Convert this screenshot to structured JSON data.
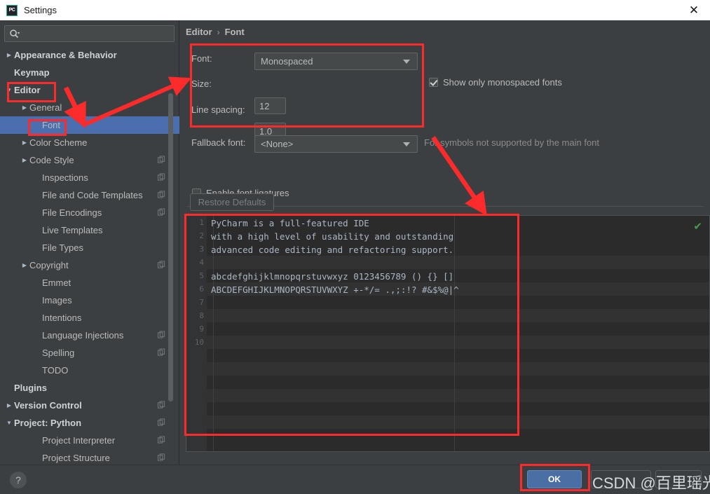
{
  "window": {
    "title": "Settings",
    "app_icon": "PC",
    "close_label": "✕"
  },
  "sidebar": {
    "search": {
      "placeholder": "",
      "value": "",
      "icon": "search-icon"
    },
    "items": [
      {
        "label": "Appearance & Behavior",
        "level": 0,
        "twisty": "▶",
        "bold": true,
        "copy": false,
        "selected": false
      },
      {
        "label": "Keymap",
        "level": 0,
        "twisty": "",
        "bold": true,
        "copy": false,
        "selected": false
      },
      {
        "label": "Editor",
        "level": 0,
        "twisty": "▼",
        "bold": true,
        "copy": false,
        "selected": false
      },
      {
        "label": "General",
        "level": 1,
        "twisty": "▶",
        "bold": false,
        "copy": false,
        "selected": false
      },
      {
        "label": "Font",
        "level": 2,
        "twisty": "",
        "bold": false,
        "copy": false,
        "selected": true
      },
      {
        "label": "Color Scheme",
        "level": 1,
        "twisty": "▶",
        "bold": false,
        "copy": false,
        "selected": false
      },
      {
        "label": "Code Style",
        "level": 1,
        "twisty": "▶",
        "bold": false,
        "copy": true,
        "selected": false
      },
      {
        "label": "Inspections",
        "level": 2,
        "twisty": "",
        "bold": false,
        "copy": true,
        "selected": false
      },
      {
        "label": "File and Code Templates",
        "level": 2,
        "twisty": "",
        "bold": false,
        "copy": true,
        "selected": false
      },
      {
        "label": "File Encodings",
        "level": 2,
        "twisty": "",
        "bold": false,
        "copy": true,
        "selected": false
      },
      {
        "label": "Live Templates",
        "level": 2,
        "twisty": "",
        "bold": false,
        "copy": false,
        "selected": false
      },
      {
        "label": "File Types",
        "level": 2,
        "twisty": "",
        "bold": false,
        "copy": false,
        "selected": false
      },
      {
        "label": "Copyright",
        "level": 1,
        "twisty": "▶",
        "bold": false,
        "copy": true,
        "selected": false
      },
      {
        "label": "Emmet",
        "level": 2,
        "twisty": "",
        "bold": false,
        "copy": false,
        "selected": false
      },
      {
        "label": "Images",
        "level": 2,
        "twisty": "",
        "bold": false,
        "copy": false,
        "selected": false
      },
      {
        "label": "Intentions",
        "level": 2,
        "twisty": "",
        "bold": false,
        "copy": false,
        "selected": false
      },
      {
        "label": "Language Injections",
        "level": 2,
        "twisty": "",
        "bold": false,
        "copy": true,
        "selected": false
      },
      {
        "label": "Spelling",
        "level": 2,
        "twisty": "",
        "bold": false,
        "copy": true,
        "selected": false
      },
      {
        "label": "TODO",
        "level": 2,
        "twisty": "",
        "bold": false,
        "copy": false,
        "selected": false
      },
      {
        "label": "Plugins",
        "level": 0,
        "twisty": "",
        "bold": true,
        "copy": false,
        "selected": false
      },
      {
        "label": "Version Control",
        "level": 0,
        "twisty": "▶",
        "bold": true,
        "copy": true,
        "selected": false
      },
      {
        "label": "Project: Python",
        "level": 0,
        "twisty": "▼",
        "bold": true,
        "copy": true,
        "selected": false
      },
      {
        "label": "Project Interpreter",
        "level": 2,
        "twisty": "",
        "bold": false,
        "copy": true,
        "selected": false
      },
      {
        "label": "Project Structure",
        "level": 2,
        "twisty": "",
        "bold": false,
        "copy": true,
        "selected": false
      }
    ]
  },
  "breadcrumb": {
    "parent": "Editor",
    "separator": "›",
    "current": "Font"
  },
  "font_settings": {
    "font_label": "Font:",
    "font_value": "Monospaced",
    "size_label": "Size:",
    "size_value": "12",
    "line_spacing_label": "Line spacing:",
    "line_spacing_value": "1.0",
    "show_only_monospaced_label": "Show only monospaced fonts",
    "show_only_monospaced_checked": true,
    "fallback_label": "Fallback font:",
    "fallback_value": "<None>",
    "fallback_hint": "For symbols not supported by the main font",
    "ligatures_label": "Enable font ligatures",
    "ligatures_checked": false,
    "restore_defaults_label": "Restore Defaults"
  },
  "preview": {
    "line_numbers": [
      "1",
      "2",
      "3",
      "4",
      "5",
      "6",
      "7",
      "8",
      "9",
      "10"
    ],
    "lines": [
      "PyCharm is a full-featured IDE",
      "with a high level of usability and outstanding",
      "advanced code editing and refactoring support.",
      "",
      "abcdefghijklmnopqrstuvwxyz 0123456789 () {} []",
      "ABCDEFGHIJKLMNOPQRSTUVWXYZ +-*/= .,;:!? #&$%@|^",
      "",
      "",
      "",
      ""
    ],
    "status_icon": "✔"
  },
  "footer": {
    "help_label": "?",
    "ok_label": "OK",
    "watermark": "CSDN @百里瑶光"
  },
  "colors": {
    "accent_blue": "#4b6eaf",
    "annotation_red": "#fc2b2b",
    "panel_bg": "#3c3f41",
    "editor_bg": "#2b2b2b",
    "text": "#bbbbbb",
    "status_green": "#4a9b4a"
  }
}
